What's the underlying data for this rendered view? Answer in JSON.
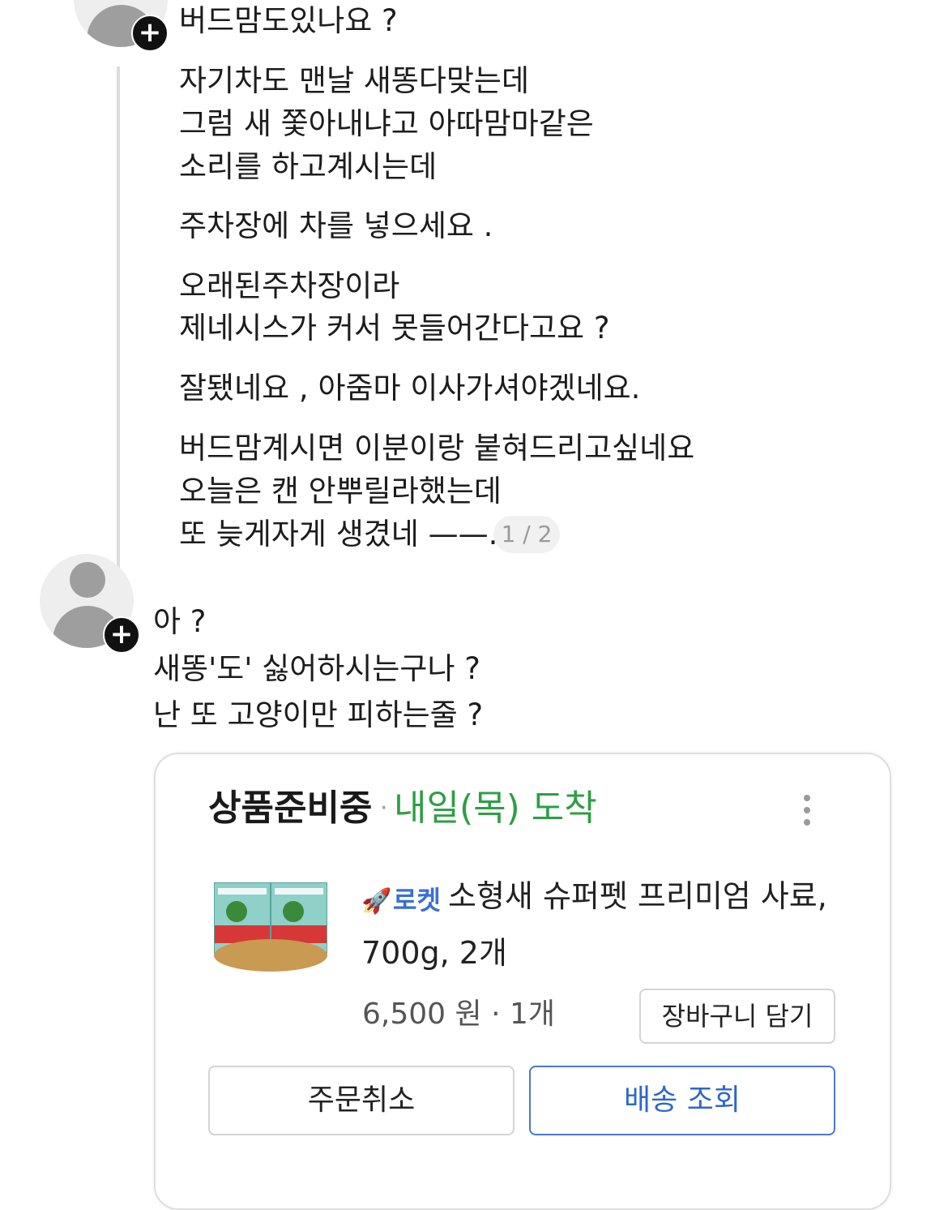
{
  "comment_1": {
    "lines": [
      "버드맘도있나요 ?",
      "자기차도 맨날 새똥다맞는데",
      "그럼 새 쫓아내냐고 아따맘마같은",
      "소리를 하고계시는데",
      "주차장에 차를 넣으세요 .",
      "오래된주차장이라",
      "제네시스가 커서 못들어간다고요 ?",
      "잘됐네요 , 아줌마 이사가셔야겠네요.",
      "버드맘계시면 이분이랑 붙혀드리고싶네요",
      "오늘은 캔 안뿌릴라했는데",
      "또 늦게자게 생겼네 ——."
    ],
    "pager": "1 / 2"
  },
  "comment_2": {
    "lines": [
      "아 ?",
      "새똥'도' 싫어하시는구나 ?",
      "난 또 고양이만 피하는줄 ?"
    ]
  },
  "order_card": {
    "status": "상품준비중",
    "dot": "·",
    "eta": "내일(목) 도착",
    "rocket_label": "로켓",
    "product_line1": "소형새 슈퍼펫 프리미엄 사료,",
    "product_line2": "700g, 2개",
    "price": "6,500 원 · 1개",
    "cart_button": "장바구니 담기",
    "cancel_button": "주문취소",
    "track_button": "배송 조회",
    "icons": {
      "menu": "kebab-menu-icon",
      "rocket": "rocket-icon"
    },
    "colors": {
      "eta": "#2e9e45",
      "rocket": "#3a6fd8",
      "track": "#2f67c8"
    }
  }
}
